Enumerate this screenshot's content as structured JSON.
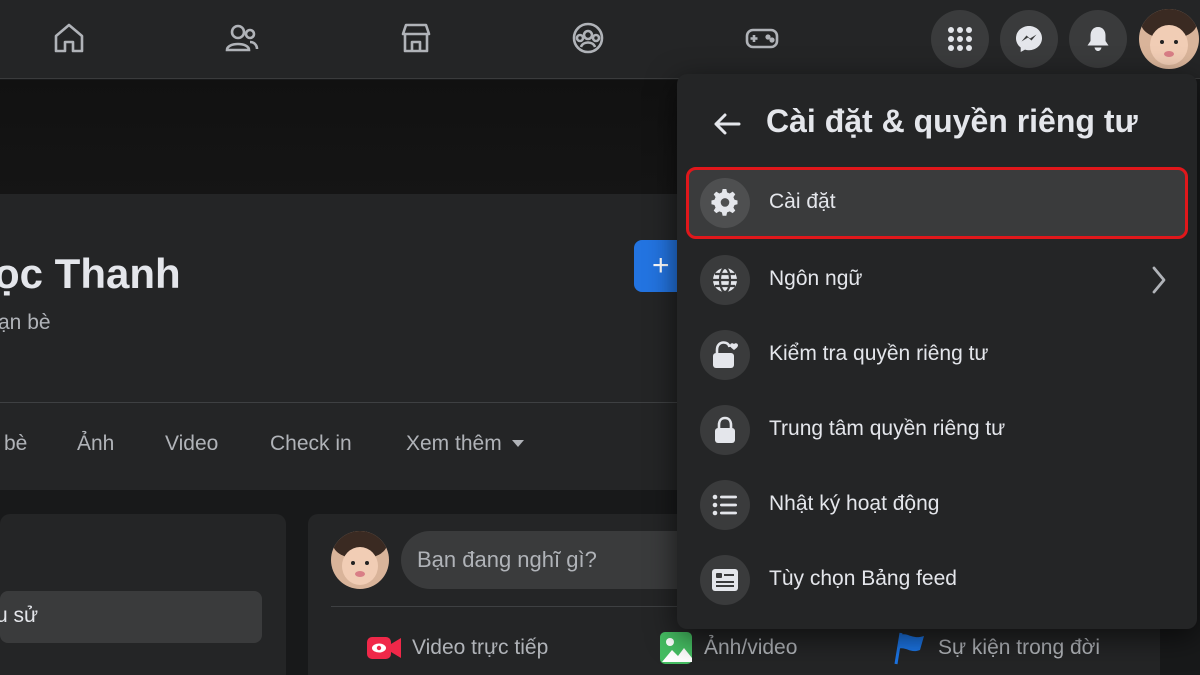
{
  "profile": {
    "name": "ọc Thanh",
    "friends": "ạn bè"
  },
  "tabs": {
    "friends": "bè",
    "photos": "Ảnh",
    "video": "Video",
    "checkin": "Check in",
    "more": "Xem thêm"
  },
  "add_story": "+",
  "left_pill": "u sử",
  "composer": {
    "placeholder": "Bạn đang nghĩ gì?",
    "actions": [
      {
        "label": "Video trực tiếp",
        "icon": "live-video-icon",
        "color": "#f02849"
      },
      {
        "label": "Ảnh/video",
        "icon": "photo-icon",
        "color": "#45bd62"
      },
      {
        "label": "Sự kiện trong đời",
        "icon": "flag-icon",
        "color": "#1b74e4"
      }
    ]
  },
  "panel": {
    "title": "Cài đặt & quyền riêng tư",
    "items": [
      {
        "label": "Cài đặt",
        "icon": "gear-icon",
        "highlighted": true
      },
      {
        "label": "Ngôn ngữ",
        "icon": "globe-icon",
        "has_submenu": true
      },
      {
        "label": "Kiểm tra quyền riêng tư",
        "icon": "lock-heart-icon"
      },
      {
        "label": "Trung tâm quyền riêng tư",
        "icon": "lock-icon"
      },
      {
        "label": "Nhật ký hoạt động",
        "icon": "list-icon"
      },
      {
        "label": "Tùy chọn Bảng feed",
        "icon": "feed-icon"
      }
    ]
  },
  "colors": {
    "background": "#18191a",
    "surface": "#242526",
    "hover": "#3a3b3c",
    "accent": "#2374e1",
    "highlight_border": "#e0171b",
    "text_primary": "#e4e6eb",
    "text_secondary": "#b0b3b8"
  }
}
